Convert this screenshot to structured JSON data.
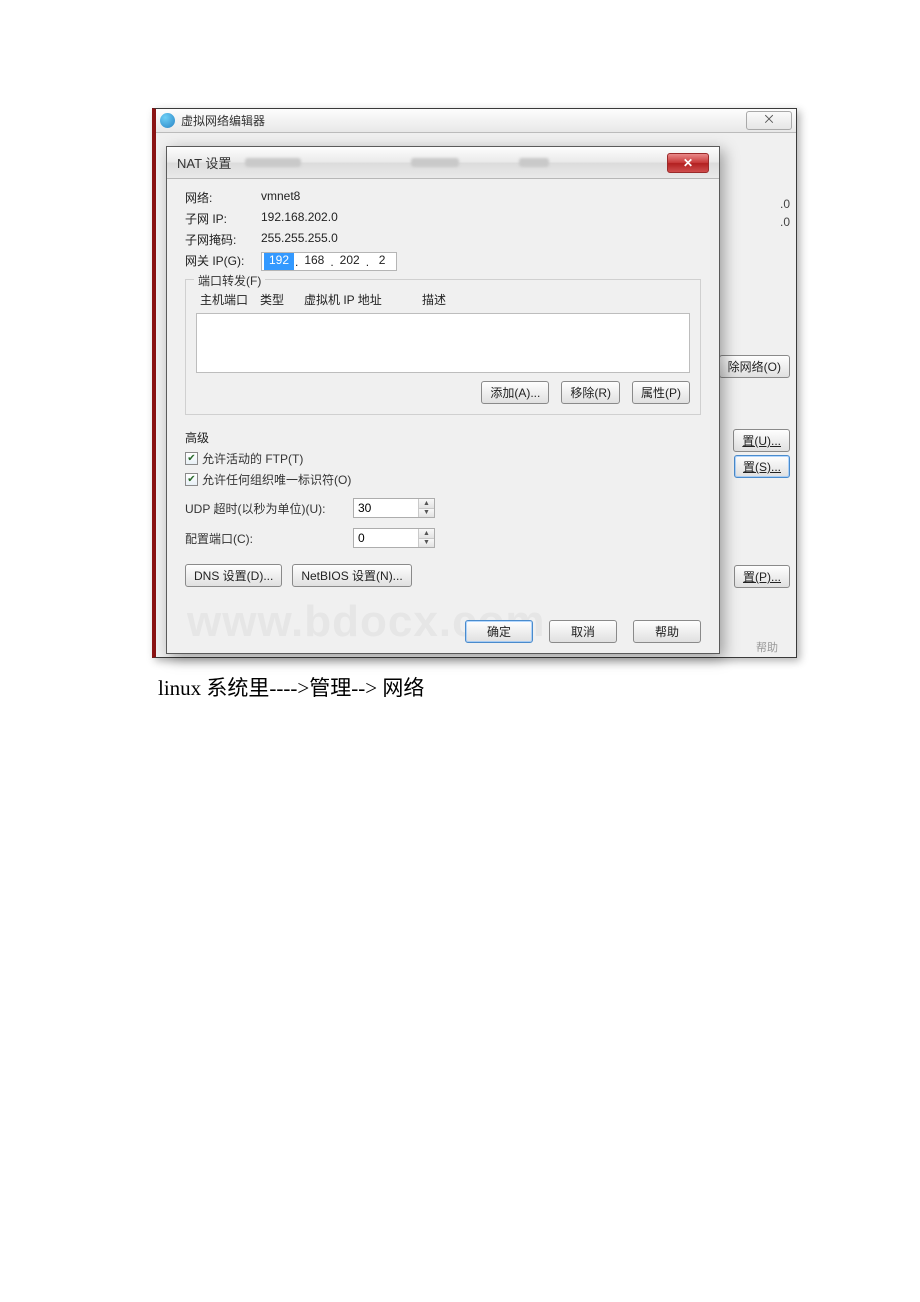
{
  "parent": {
    "title": "虚拟网络编辑器",
    "close_glyph": "⨉",
    "bg_ip_suffix_a": ".0",
    "bg_ip_suffix_b": ".0",
    "remove_net_btn": "除网络(O)",
    "bg_btn_u": "置(U)...",
    "bg_btn_s": "置(S)...",
    "bg_btn_p": "置(P)...",
    "help_partial": "帮助"
  },
  "nat": {
    "title": "NAT 设置",
    "close_glyph": "✕",
    "labels": {
      "network": "网络:",
      "subnet_ip": "子网 IP:",
      "subnet_mask": "子网掩码:",
      "gateway_ip": "网关 IP(G):"
    },
    "values": {
      "network": "vmnet8",
      "subnet_ip": "192.168.202.0",
      "subnet_mask": "255.255.255.0",
      "gateway_oct1": "192",
      "gateway_oct2": "168",
      "gateway_oct3": "202",
      "gateway_oct4": "2"
    },
    "port_forward": {
      "legend": "端口转发(F)",
      "col_host_port": "主机端口",
      "col_type": "类型",
      "col_vm_ip": "虚拟机 IP 地址",
      "col_desc": "描述",
      "add_btn": "添加(A)...",
      "remove_btn": "移除(R)",
      "props_btn": "属性(P)"
    },
    "advanced": {
      "legend": "高级",
      "allow_ftp": "允许活动的 FTP(T)",
      "allow_oui": "允许任何组织唯一标识符(O)",
      "udp_timeout_label": "UDP 超时(以秒为单位)(U):",
      "udp_timeout_value": "30",
      "config_port_label": "配置端口(C):",
      "config_port_value": "0",
      "dns_btn": "DNS 设置(D)...",
      "netbios_btn": "NetBIOS 设置(N)..."
    },
    "footer": {
      "ok": "确定",
      "cancel": "取消",
      "help": "帮助"
    }
  },
  "watermark": "www.bdocx.com",
  "caption": "linux 系统里---->管理--> 网络"
}
